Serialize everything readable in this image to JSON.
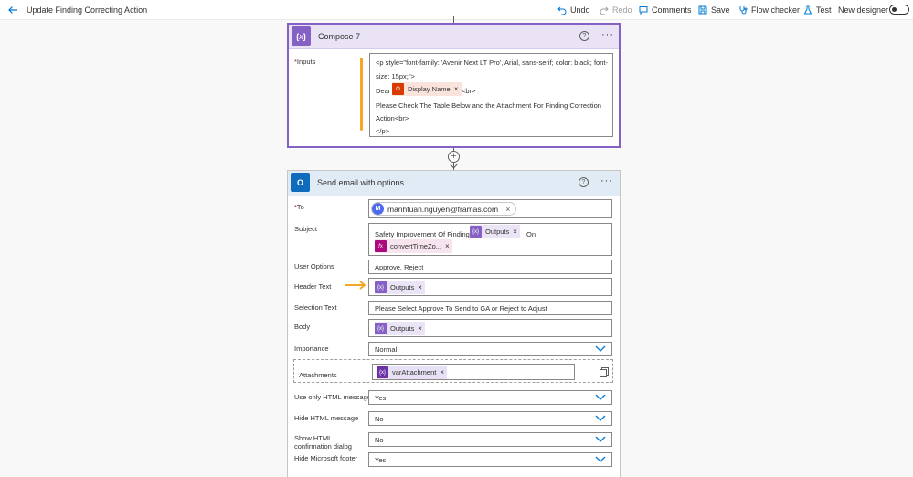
{
  "topbar": {
    "title": "Update Finding Correcting Action",
    "undo": "Undo",
    "redo": "Redo",
    "comments": "Comments",
    "save": "Save",
    "flow_checker": "Flow checker",
    "test": "Test",
    "new_designer": "New designer"
  },
  "compose": {
    "title": "Compose 7",
    "inputs_label": "Inputs",
    "line1a": "<p style=\"font-family: 'Avenir Next LT Pro', Arial, sans-serif; color: black; font-",
    "line1b": "size: 15px;\">",
    "dear": "Dear",
    "display_name_token": "Display Name",
    "br": "<br>",
    "line3a": "Please Check The Table Below and the Attachment For Finding Correction",
    "line3b": "Action<br>",
    "line4": "</p>"
  },
  "email": {
    "title": "Send email with options",
    "to_label": "To",
    "to_value": "manhtuan.nguyen@framas.com",
    "to_initial": "M",
    "subject_label": "Subject",
    "subject_text": "Safety Improvement Of Finding",
    "subject_token": "Outputs",
    "subject_on": "On",
    "subject_fx": "convertTimeZo...",
    "user_options_label": "User Options",
    "user_options_value": "Approve, Reject",
    "header_text_label": "Header Text",
    "header_text_token": "Outputs",
    "selection_text_label": "Selection Text",
    "selection_text_value": "Please Select Approve To Send to GA or Reject to Adjust",
    "body_label": "Body",
    "body_token": "Outputs",
    "importance_label": "Importance",
    "importance_value": "Normal",
    "attachments_label": "Attachments",
    "attachments_token": "varAttachment",
    "html_only_label": "Use only HTML message",
    "html_only_value": "Yes",
    "hide_html_label": "Hide HTML message",
    "hide_html_value": "No",
    "show_html_label1": "Show HTML",
    "show_html_label2": "confirmation dialog",
    "show_html_value": "No",
    "hide_footer_label": "Hide Microsoft footer",
    "hide_footer_value": "Yes"
  },
  "colors": {
    "compose_accent": "#8661c5",
    "outlook_accent": "#0f6cbd",
    "annotation": "#f5a623"
  }
}
